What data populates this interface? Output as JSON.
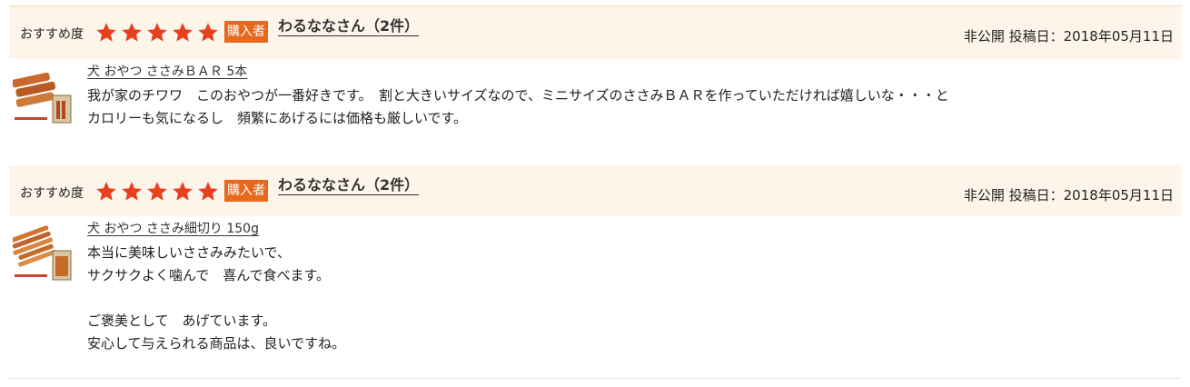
{
  "reviews": [
    {
      "rec_label": "おすすめ度",
      "stars": 5,
      "badge": "購入者",
      "reviewer": "わるななさん（2件）",
      "visibility": "非公開",
      "date_label": "投稿日：2018年05月11日",
      "product": "犬 おやつ ささみＢＡＲ 5本",
      "lines": [
        "我が家のチワワ　このおやつが一番好きです。　割と大きいサイズなので、ミニサイズのささみＢＡＲを作っていただければ嬉しいな・・・と",
        "カロリーも気になるし　頻繁にあげるには価格も厳しいです。"
      ]
    },
    {
      "rec_label": "おすすめ度",
      "stars": 5,
      "badge": "購入者",
      "reviewer": "わるななさん（2件）",
      "visibility": "非公開",
      "date_label": "投稿日：2018年05月11日",
      "product": "犬 おやつ ささみ細切り 150g",
      "lines": [
        "本当に美味しいささみみたいで、",
        "サクサクよく噛んで　喜んで食べます。",
        "",
        "ご褒美として　あげています。",
        "安心して与えられる商品は、良いですね。"
      ]
    }
  ],
  "colors": {
    "star": "#e8401c",
    "badge": "#e8681c",
    "header_bg": "#fdf5ea"
  },
  "icons": {
    "star": "star-icon",
    "thumb": "product-thumbnail"
  }
}
